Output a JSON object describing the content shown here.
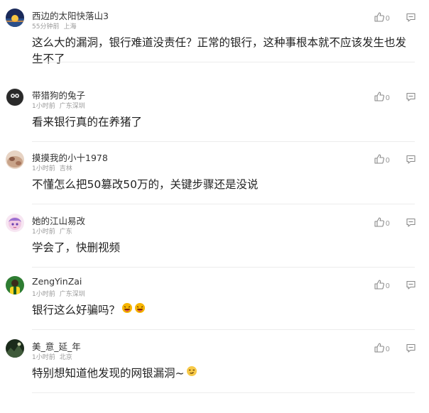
{
  "comments": [
    {
      "username": "西边的太阳快落山3",
      "time": "55分钟前",
      "location": "上海",
      "text": "这么大的漏洞，银行难道没责任？正常的银行，这种事根本就不应该发生也发生不了",
      "likes": "0",
      "avatar_colors": [
        "#1a2a5a",
        "#f5c542"
      ],
      "avatar_icon": "sunset-avatar"
    },
    {
      "username": "带猎狗的兔子",
      "time": "1小时前",
      "location": "广东深圳",
      "text": "看来银行真的在养猪了",
      "likes": "0",
      "avatar_colors": [
        "#2a2a2a",
        "#dcdcdc"
      ],
      "avatar_icon": "dark-avatar"
    },
    {
      "username": "摸摸我的小十1978",
      "time": "1小时前",
      "location": "吉林",
      "text": "不懂怎么把50篡改50万的，关键步骤还是没说",
      "likes": "0",
      "avatar_colors": [
        "#c9a48a",
        "#8a5a46"
      ],
      "avatar_icon": "pet-avatar"
    },
    {
      "username": "她的江山易改",
      "time": "1小时前",
      "location": "广东",
      "text": "学会了，快删视频",
      "likes": "0",
      "avatar_colors": [
        "#f1c9e3",
        "#9b6fd1"
      ],
      "avatar_icon": "anime-avatar"
    },
    {
      "username": "ZengYinZai",
      "time": "1小时前",
      "location": "广东深圳",
      "text": "银行这么好骗吗？",
      "likes": "0",
      "avatar_colors": [
        "#2e7d32",
        "#f9d423"
      ],
      "avatar_icon": "football-avatar",
      "emojis": [
        "laughing-emoji",
        "laughing-emoji"
      ]
    },
    {
      "username": "美_意_延_年",
      "time": "1小时前",
      "location": "北京",
      "text": "特别想知道他发现的网银漏洞~",
      "likes": "0",
      "avatar_colors": [
        "#1b2b1b",
        "#3f5a3a"
      ],
      "avatar_icon": "landscape-avatar",
      "emojis": [
        "smirk-emoji"
      ]
    }
  ]
}
